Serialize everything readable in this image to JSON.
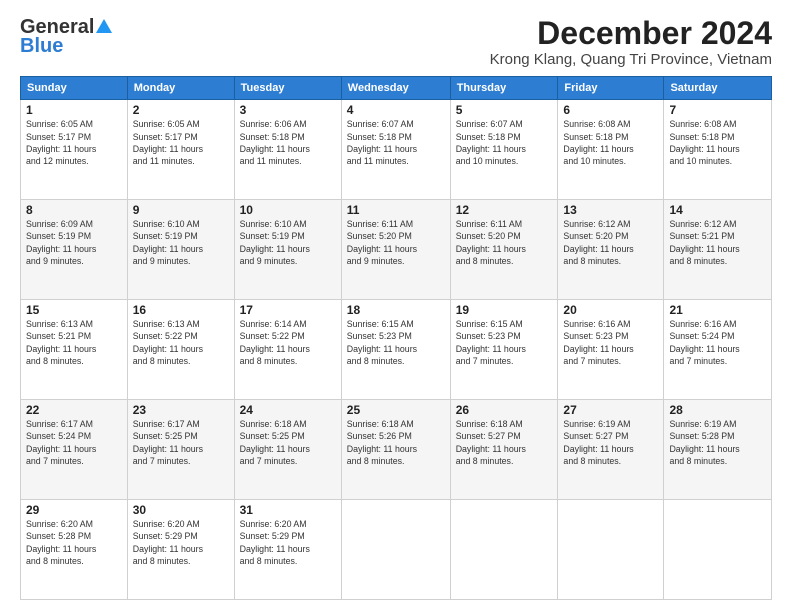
{
  "header": {
    "logo_line1": "General",
    "logo_line2": "Blue",
    "title": "December 2024",
    "subtitle": "Krong Klang, Quang Tri Province, Vietnam"
  },
  "days_of_week": [
    "Sunday",
    "Monday",
    "Tuesday",
    "Wednesday",
    "Thursday",
    "Friday",
    "Saturday"
  ],
  "weeks": [
    [
      {
        "day": "1",
        "detail": "Sunrise: 6:05 AM\nSunset: 5:17 PM\nDaylight: 11 hours\nand 12 minutes."
      },
      {
        "day": "2",
        "detail": "Sunrise: 6:05 AM\nSunset: 5:17 PM\nDaylight: 11 hours\nand 11 minutes."
      },
      {
        "day": "3",
        "detail": "Sunrise: 6:06 AM\nSunset: 5:18 PM\nDaylight: 11 hours\nand 11 minutes."
      },
      {
        "day": "4",
        "detail": "Sunrise: 6:07 AM\nSunset: 5:18 PM\nDaylight: 11 hours\nand 11 minutes."
      },
      {
        "day": "5",
        "detail": "Sunrise: 6:07 AM\nSunset: 5:18 PM\nDaylight: 11 hours\nand 10 minutes."
      },
      {
        "day": "6",
        "detail": "Sunrise: 6:08 AM\nSunset: 5:18 PM\nDaylight: 11 hours\nand 10 minutes."
      },
      {
        "day": "7",
        "detail": "Sunrise: 6:08 AM\nSunset: 5:18 PM\nDaylight: 11 hours\nand 10 minutes."
      }
    ],
    [
      {
        "day": "8",
        "detail": "Sunrise: 6:09 AM\nSunset: 5:19 PM\nDaylight: 11 hours\nand 9 minutes."
      },
      {
        "day": "9",
        "detail": "Sunrise: 6:10 AM\nSunset: 5:19 PM\nDaylight: 11 hours\nand 9 minutes."
      },
      {
        "day": "10",
        "detail": "Sunrise: 6:10 AM\nSunset: 5:19 PM\nDaylight: 11 hours\nand 9 minutes."
      },
      {
        "day": "11",
        "detail": "Sunrise: 6:11 AM\nSunset: 5:20 PM\nDaylight: 11 hours\nand 9 minutes."
      },
      {
        "day": "12",
        "detail": "Sunrise: 6:11 AM\nSunset: 5:20 PM\nDaylight: 11 hours\nand 8 minutes."
      },
      {
        "day": "13",
        "detail": "Sunrise: 6:12 AM\nSunset: 5:20 PM\nDaylight: 11 hours\nand 8 minutes."
      },
      {
        "day": "14",
        "detail": "Sunrise: 6:12 AM\nSunset: 5:21 PM\nDaylight: 11 hours\nand 8 minutes."
      }
    ],
    [
      {
        "day": "15",
        "detail": "Sunrise: 6:13 AM\nSunset: 5:21 PM\nDaylight: 11 hours\nand 8 minutes."
      },
      {
        "day": "16",
        "detail": "Sunrise: 6:13 AM\nSunset: 5:22 PM\nDaylight: 11 hours\nand 8 minutes."
      },
      {
        "day": "17",
        "detail": "Sunrise: 6:14 AM\nSunset: 5:22 PM\nDaylight: 11 hours\nand 8 minutes."
      },
      {
        "day": "18",
        "detail": "Sunrise: 6:15 AM\nSunset: 5:23 PM\nDaylight: 11 hours\nand 8 minutes."
      },
      {
        "day": "19",
        "detail": "Sunrise: 6:15 AM\nSunset: 5:23 PM\nDaylight: 11 hours\nand 7 minutes."
      },
      {
        "day": "20",
        "detail": "Sunrise: 6:16 AM\nSunset: 5:23 PM\nDaylight: 11 hours\nand 7 minutes."
      },
      {
        "day": "21",
        "detail": "Sunrise: 6:16 AM\nSunset: 5:24 PM\nDaylight: 11 hours\nand 7 minutes."
      }
    ],
    [
      {
        "day": "22",
        "detail": "Sunrise: 6:17 AM\nSunset: 5:24 PM\nDaylight: 11 hours\nand 7 minutes."
      },
      {
        "day": "23",
        "detail": "Sunrise: 6:17 AM\nSunset: 5:25 PM\nDaylight: 11 hours\nand 7 minutes."
      },
      {
        "day": "24",
        "detail": "Sunrise: 6:18 AM\nSunset: 5:25 PM\nDaylight: 11 hours\nand 7 minutes."
      },
      {
        "day": "25",
        "detail": "Sunrise: 6:18 AM\nSunset: 5:26 PM\nDaylight: 11 hours\nand 8 minutes."
      },
      {
        "day": "26",
        "detail": "Sunrise: 6:18 AM\nSunset: 5:27 PM\nDaylight: 11 hours\nand 8 minutes."
      },
      {
        "day": "27",
        "detail": "Sunrise: 6:19 AM\nSunset: 5:27 PM\nDaylight: 11 hours\nand 8 minutes."
      },
      {
        "day": "28",
        "detail": "Sunrise: 6:19 AM\nSunset: 5:28 PM\nDaylight: 11 hours\nand 8 minutes."
      }
    ],
    [
      {
        "day": "29",
        "detail": "Sunrise: 6:20 AM\nSunset: 5:28 PM\nDaylight: 11 hours\nand 8 minutes."
      },
      {
        "day": "30",
        "detail": "Sunrise: 6:20 AM\nSunset: 5:29 PM\nDaylight: 11 hours\nand 8 minutes."
      },
      {
        "day": "31",
        "detail": "Sunrise: 6:20 AM\nSunset: 5:29 PM\nDaylight: 11 hours\nand 8 minutes."
      },
      null,
      null,
      null,
      null
    ]
  ]
}
